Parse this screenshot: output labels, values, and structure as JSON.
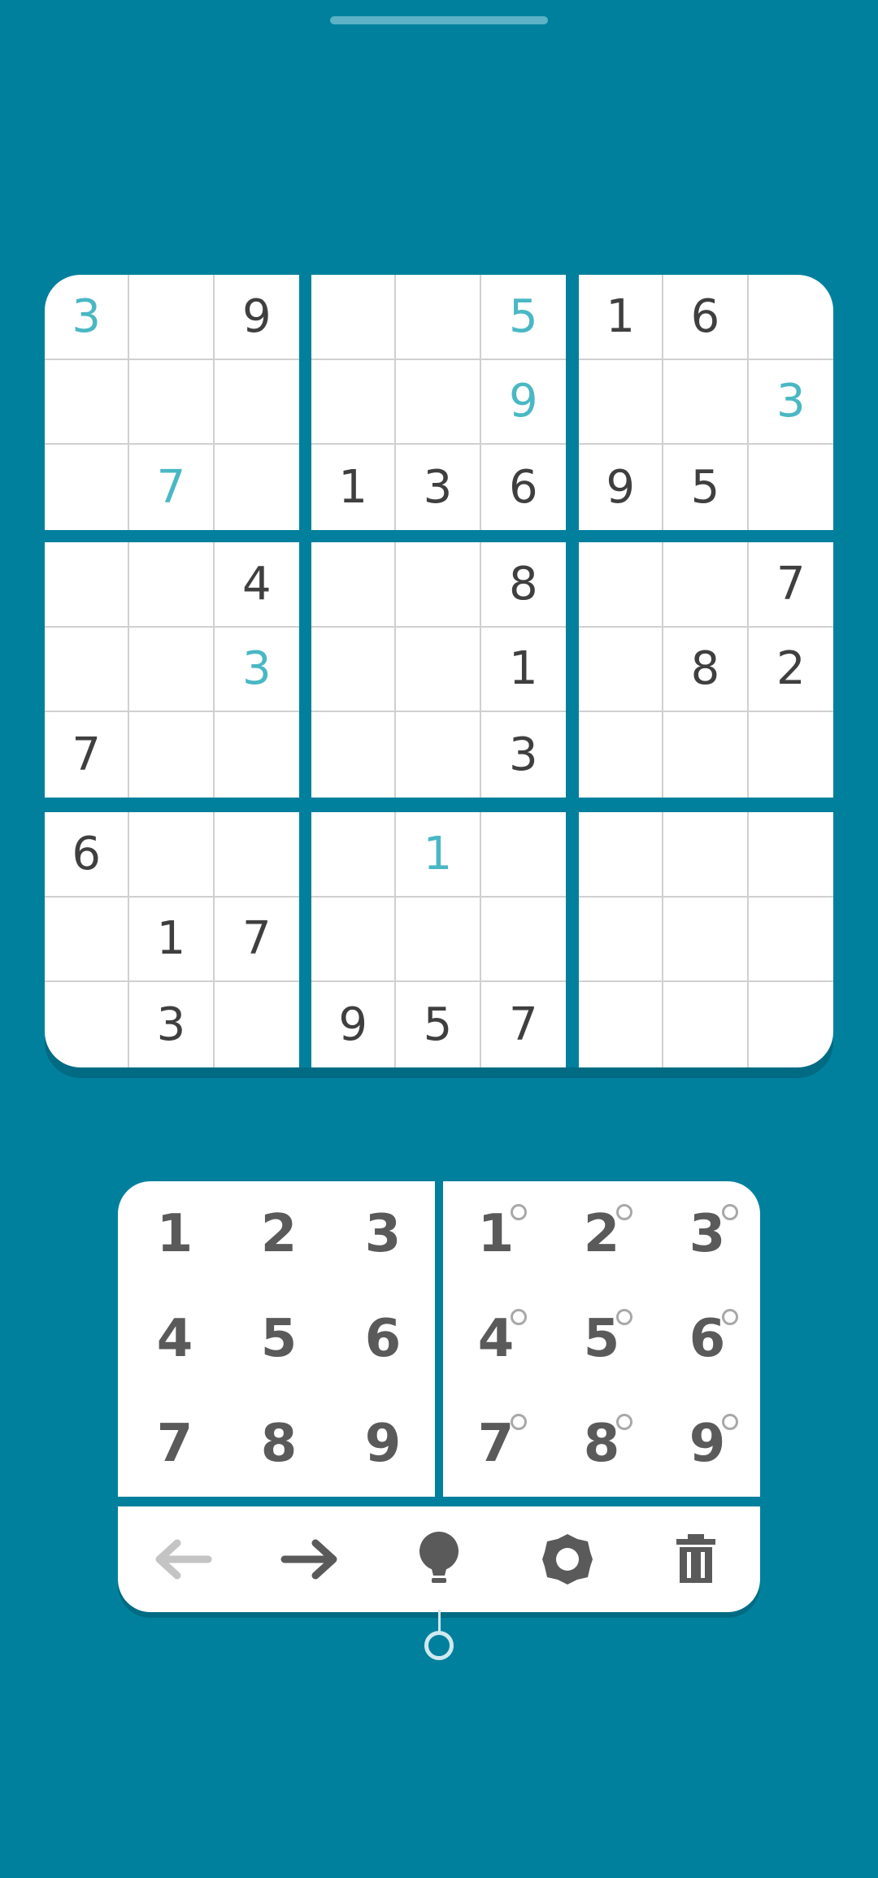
{
  "board": {
    "boxes": [
      [
        {
          "v": "3",
          "u": true
        },
        {
          "v": ""
        },
        {
          "v": "9"
        },
        {
          "v": ""
        },
        {
          "v": ""
        },
        {
          "v": ""
        },
        {
          "v": ""
        },
        {
          "v": "7",
          "u": true
        },
        {
          "v": ""
        }
      ],
      [
        {
          "v": ""
        },
        {
          "v": ""
        },
        {
          "v": "5",
          "u": true
        },
        {
          "v": ""
        },
        {
          "v": ""
        },
        {
          "v": "9",
          "u": true
        },
        {
          "v": "1"
        },
        {
          "v": "3"
        },
        {
          "v": "6"
        }
      ],
      [
        {
          "v": "1"
        },
        {
          "v": "6"
        },
        {
          "v": ""
        },
        {
          "v": ""
        },
        {
          "v": ""
        },
        {
          "v": "3",
          "u": true
        },
        {
          "v": "9"
        },
        {
          "v": "5"
        },
        {
          "v": ""
        }
      ],
      [
        {
          "v": ""
        },
        {
          "v": ""
        },
        {
          "v": "4"
        },
        {
          "v": ""
        },
        {
          "v": ""
        },
        {
          "v": "3",
          "u": true
        },
        {
          "v": "7"
        },
        {
          "v": ""
        },
        {
          "v": ""
        }
      ],
      [
        {
          "v": ""
        },
        {
          "v": ""
        },
        {
          "v": "8"
        },
        {
          "v": ""
        },
        {
          "v": ""
        },
        {
          "v": "1"
        },
        {
          "v": ""
        },
        {
          "v": ""
        },
        {
          "v": "3"
        }
      ],
      [
        {
          "v": ""
        },
        {
          "v": ""
        },
        {
          "v": "7"
        },
        {
          "v": ""
        },
        {
          "v": "8"
        },
        {
          "v": "2"
        },
        {
          "v": ""
        },
        {
          "v": ""
        },
        {
          "v": ""
        }
      ],
      [
        {
          "v": "6"
        },
        {
          "v": ""
        },
        {
          "v": ""
        },
        {
          "v": ""
        },
        {
          "v": "1"
        },
        {
          "v": "7"
        },
        {
          "v": ""
        },
        {
          "v": "3"
        },
        {
          "v": ""
        }
      ],
      [
        {
          "v": ""
        },
        {
          "v": "1",
          "u": true
        },
        {
          "v": ""
        },
        {
          "v": ""
        },
        {
          "v": ""
        },
        {
          "v": ""
        },
        {
          "v": "9"
        },
        {
          "v": "5"
        },
        {
          "v": "7"
        }
      ],
      [
        {
          "v": ""
        },
        {
          "v": ""
        },
        {
          "v": ""
        },
        {
          "v": ""
        },
        {
          "v": ""
        },
        {
          "v": ""
        },
        {
          "v": ""
        },
        {
          "v": ""
        },
        {
          "v": ""
        }
      ]
    ]
  },
  "pad": {
    "numbers": [
      "1",
      "2",
      "3",
      "4",
      "5",
      "6",
      "7",
      "8",
      "9"
    ],
    "notes": [
      "1",
      "2",
      "3",
      "4",
      "5",
      "6",
      "7",
      "8",
      "9"
    ]
  },
  "toolbar": {
    "icons": [
      "undo-arrow-icon",
      "redo-arrow-icon",
      "hint-lightbulb-icon",
      "settings-gear-icon",
      "delete-trash-icon"
    ],
    "undo_enabled": false
  },
  "colors": {
    "background": "#00809d",
    "given": "#3f3f3f",
    "user": "#4ab8c4"
  }
}
